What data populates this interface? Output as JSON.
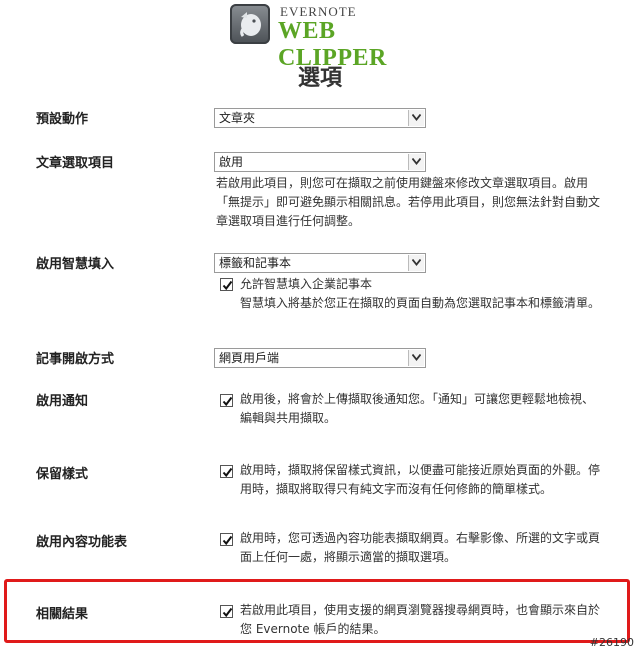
{
  "header": {
    "logo_top": "EVERNOTE",
    "logo_main": "WEB CLIPPER",
    "page_title": "選項"
  },
  "options": {
    "default_action": {
      "label": "預設動作",
      "selected": "文章夾"
    },
    "article_selection": {
      "label": "文章選取項目",
      "selected": "啟用",
      "help_line1": "若啟用此項目，則您可在擷取之前使用鍵盤來修改文章選取項目。啟用",
      "help_line2": "「無提示」即可避免顯示相關訊息。若停用此項目，則您無法針對自動文",
      "help_line3": "章選取項目進行任何調整。"
    },
    "smart_filing": {
      "label": "啟用智慧填入",
      "selected": "標籤和記事本",
      "checkbox_label": "允許智慧填入企業記事本",
      "checked": true,
      "help": "智慧填入將基於您正在擷取的頁面自動為您選取記事本和標籤清單。"
    },
    "open_note": {
      "label": "記事開啟方式",
      "selected": "網頁用戶端"
    },
    "notifications": {
      "label": "啟用通知",
      "checked": true,
      "text_line1": "啟用後，將會於上傳擷取後通知您。「通知」可讓您更輕鬆地檢視、",
      "text_line2": "編輯與共用擷取。"
    },
    "keep_styles": {
      "label": "保留樣式",
      "checked": true,
      "text_line1": "啟用時，擷取將保留樣式資訊，以便盡可能接近原始頁面的外觀。停",
      "text_line2": "用時，擷取將取得只有純文字而沒有任何修飾的簡單樣式。"
    },
    "context_menu": {
      "label": "啟用內容功能表",
      "checked": true,
      "text_line1": "啟用時，您可透過內容功能表擷取網頁。右擊影像、所選的文字或頁",
      "text_line2": "面上任何一處，將顯示適當的擷取選項。"
    },
    "related_results": {
      "label": "相關結果",
      "checked": true,
      "text_line1": "若啟用此項目，使用支援的網頁瀏覽器搜尋網頁時，也會顯示來自於",
      "text_line2": "您 Evernote 帳戶的結果。"
    }
  },
  "footer": {
    "watermark": "#26190"
  },
  "colors": {
    "brand_green": "#5ba525",
    "highlight_red": "#e01a1a"
  }
}
